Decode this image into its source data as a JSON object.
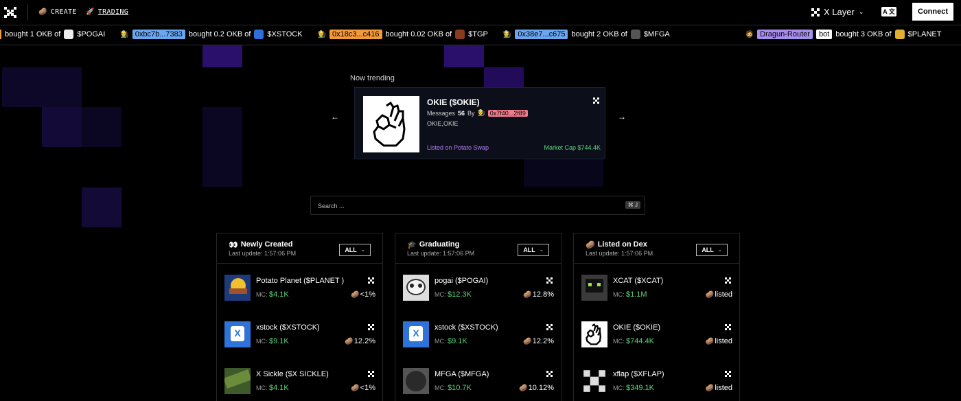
{
  "header": {
    "nav_create": "CREATE",
    "nav_trading": "TRADING",
    "chain": "X Layer",
    "lang_label": "A 文",
    "connect": "Connect"
  },
  "ticker": {
    "items": [
      {
        "address": "",
        "action": "bought 1 OKB of",
        "token": "$POGAI"
      },
      {
        "address": "0xbc7b...7383",
        "action": "bought 0.2 OKB of",
        "token": "$XSTOCK"
      },
      {
        "address": "0x18c3...c416",
        "action": "bought 0.02 OKB of",
        "token": "$TGP"
      },
      {
        "address": "0x38e7...c675",
        "action": "bought 2 OKB of",
        "token": "$MFGA"
      },
      {
        "address": "Dragun-Router",
        "tag": "bot",
        "action": "bought 3 OKB of",
        "token": "$PLANET"
      }
    ]
  },
  "trending": {
    "title": "Now trending",
    "name": "OKIE ($OKIE)",
    "messages_label": "Messages",
    "messages_count": "56",
    "by_label": "By",
    "creator": "0x7f40...2f89",
    "tags": "OKIE,OKIE",
    "listed": "Listed on Potato Swap",
    "market_cap": "Market Cap $744.4K"
  },
  "search": {
    "placeholder": "Search ...",
    "shortcut": "⌘ J"
  },
  "columns": [
    {
      "title": "Newly Created",
      "emoji": "👀",
      "last_update": "Last update: 1:57:06 PM",
      "filter": "ALL",
      "rows": [
        {
          "name": "Potato Planet ($PLANET )",
          "mc_label": "MC:",
          "mc": "$4.1K",
          "pct": "<1%"
        },
        {
          "name": "xstock ($XSTOCK)",
          "mc_label": "MC:",
          "mc": "$9.1K",
          "pct": "12.2%"
        },
        {
          "name": "X Sickle ($X SICKLE)",
          "mc_label": "MC:",
          "mc": "$4.1K",
          "pct": "<1%"
        }
      ]
    },
    {
      "title": "Graduating",
      "emoji": "🎓",
      "last_update": "Last update: 1:57:06 PM",
      "filter": "ALL",
      "rows": [
        {
          "name": "pogai ($POGAI)",
          "mc_label": "MC:",
          "mc": "$12.3K",
          "pct": "12.8%"
        },
        {
          "name": "xstock ($XSTOCK)",
          "mc_label": "MC:",
          "mc": "$9.1K",
          "pct": "12.2%"
        },
        {
          "name": "MFGA ($MFGA)",
          "mc_label": "MC:",
          "mc": "$10.7K",
          "pct": "10.12%"
        }
      ]
    },
    {
      "title": "Listed on Dex",
      "emoji": "🥔",
      "last_update": "Last update: 1:57:06 PM",
      "filter": "ALL",
      "rows": [
        {
          "name": "XCAT ($XCAT)",
          "mc_label": "MC:",
          "mc": "$1.1M",
          "pct": "listed"
        },
        {
          "name": "OKIE ($OKIE)",
          "mc_label": "MC:",
          "mc": "$744.4K",
          "pct": "listed"
        },
        {
          "name": "xflap ($XFLAP)",
          "mc_label": "MC:",
          "mc": "$349.1K",
          "pct": "listed"
        }
      ]
    }
  ],
  "colors": {
    "accent_green": "#5bd67a",
    "accent_purple": "#b67cf5",
    "grid_purple": "#3a1a8a"
  }
}
